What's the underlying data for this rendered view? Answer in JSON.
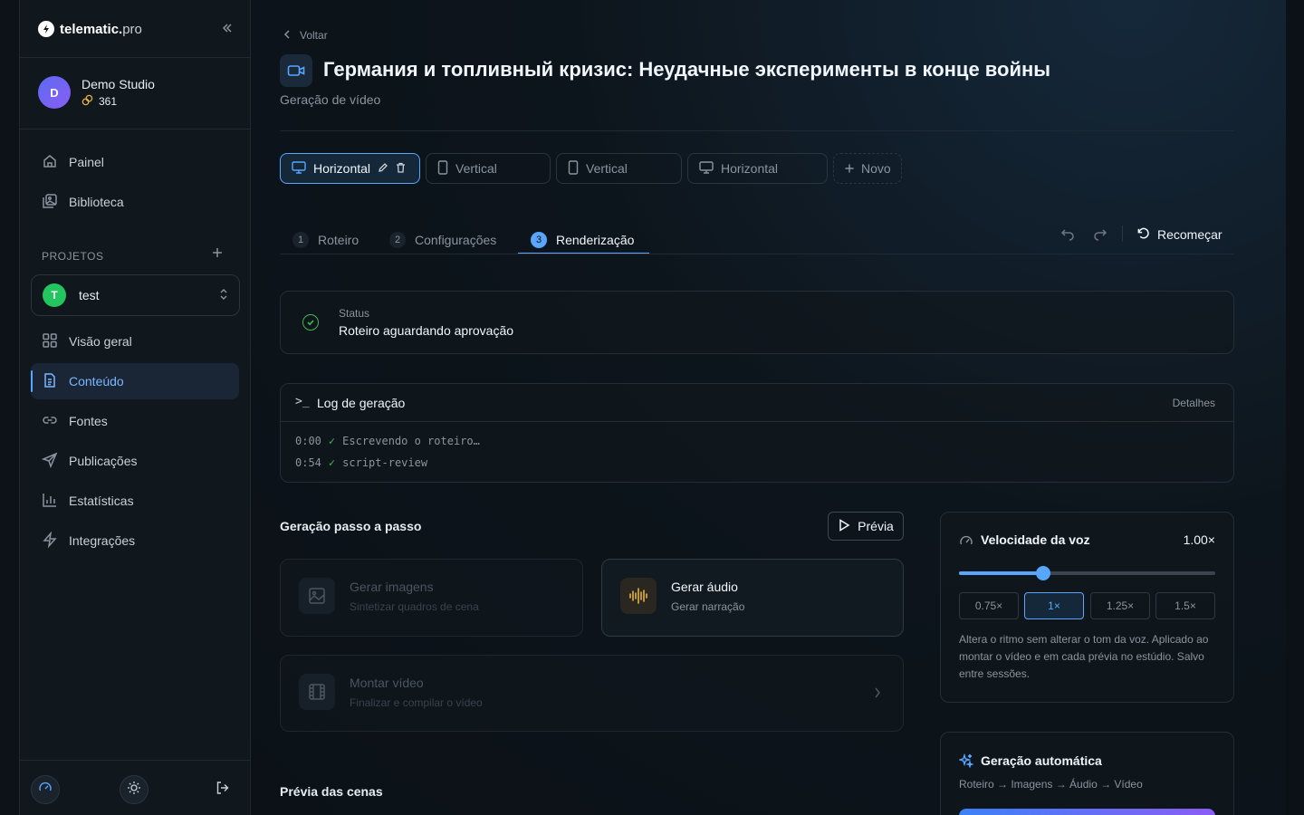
{
  "sidebar": {
    "logo_main": "telematic.",
    "logo_suffix": "pro",
    "user": {
      "initial": "D",
      "name": "Demo Studio",
      "credits": "361"
    },
    "nav_top": [
      {
        "label": "Painel",
        "icon": "home-icon"
      },
      {
        "label": "Biblioteca",
        "icon": "image-library-icon"
      }
    ],
    "projects_label": "PROJETOS",
    "project": {
      "initial": "T",
      "name": "test"
    },
    "nav_project": [
      {
        "label": "Visão geral",
        "icon": "grid-icon"
      },
      {
        "label": "Conteúdo",
        "icon": "document-icon",
        "active": true
      },
      {
        "label": "Fontes",
        "icon": "link-icon"
      },
      {
        "label": "Publicações",
        "icon": "send-icon"
      },
      {
        "label": "Estatísticas",
        "icon": "bar-chart-icon"
      },
      {
        "label": "Integrações",
        "icon": "bolt-icon"
      }
    ]
  },
  "header": {
    "back_label": "Voltar",
    "title": "Германия и топливный кризис: Неудачные эксперименты в конце войны",
    "subtitle": "Geração de vídeo"
  },
  "format_tabs": [
    {
      "label": "Horizontal",
      "icon": "monitor-icon",
      "active": true
    },
    {
      "label": "Vertical",
      "icon": "phone-icon"
    },
    {
      "label": "Vertical",
      "icon": "phone-icon"
    },
    {
      "label": "Horizontal",
      "icon": "monitor-icon"
    },
    {
      "label": "Novo",
      "icon": "plus-icon"
    }
  ],
  "steps": [
    {
      "num": "1",
      "label": "Roteiro"
    },
    {
      "num": "2",
      "label": "Configurações"
    },
    {
      "num": "3",
      "label": "Renderização",
      "active": true
    }
  ],
  "restart_label": "Recomeçar",
  "status": {
    "label": "Status",
    "value": "Roteiro aguardando aprovação"
  },
  "log": {
    "prompt": ">_",
    "title": "Log de geração",
    "details_label": "Detalhes",
    "lines": [
      {
        "time": "0:00",
        "text": "Escrevendo o roteiro…"
      },
      {
        "time": "0:54",
        "text": "script-review"
      }
    ]
  },
  "stepwise": {
    "title": "Geração passo a passo",
    "preview_label": "Prévia",
    "cards": [
      {
        "title": "Gerar imagens",
        "sub": "Sintetizar quadros de cena",
        "icon": "image-icon"
      },
      {
        "title": "Gerar áudio",
        "sub": "Gerar narração",
        "icon": "waveform-icon"
      },
      {
        "title": "Montar vídeo",
        "sub": "Finalizar e compilar o vídeo",
        "icon": "film-icon"
      }
    ]
  },
  "scenes_title": "Prévia das cenas",
  "voice_speed": {
    "title": "Velocidade da voz",
    "value": "1.00×",
    "level": 0.33,
    "presets": [
      "0.75×",
      "1×",
      "1.25×",
      "1.5×"
    ],
    "active_preset": 1,
    "help": "Altera o ritmo sem alterar o tom da voz. Aplicado ao montar o vídeo e em cada prévia no estúdio. Salvo entre sessões."
  },
  "auto": {
    "title": "Geração automática",
    "pipeline": "Roteiro → Imagens → Áudio → Vídeo"
  },
  "colors": {
    "accent": "#58a6ff",
    "success": "#3fb950",
    "project": "#22c55e"
  }
}
